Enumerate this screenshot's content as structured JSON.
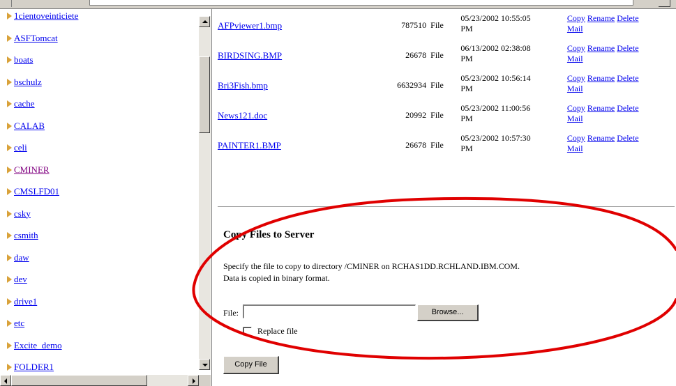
{
  "sidebar": {
    "directories": [
      {
        "label": "1cientoveinticiete",
        "visited": false
      },
      {
        "label": "ASFTomcat",
        "visited": false
      },
      {
        "label": "boats",
        "visited": false
      },
      {
        "label": "bschulz",
        "visited": false
      },
      {
        "label": "cache",
        "visited": false
      },
      {
        "label": "CALAB",
        "visited": false
      },
      {
        "label": "celi",
        "visited": false
      },
      {
        "label": "CMINER",
        "visited": true
      },
      {
        "label": "CMSLFD01",
        "visited": false
      },
      {
        "label": "csky",
        "visited": false
      },
      {
        "label": "csmith",
        "visited": false
      },
      {
        "label": "daw",
        "visited": false
      },
      {
        "label": "dev",
        "visited": false
      },
      {
        "label": "drive1",
        "visited": false
      },
      {
        "label": "etc",
        "visited": false
      },
      {
        "label": "Excite_demo",
        "visited": false
      },
      {
        "label": "FOLDER1",
        "visited": false
      }
    ]
  },
  "files": [
    {
      "name": "AFPviewer1.bmp",
      "size": "787510",
      "type": "File",
      "date": "05/23/2002 10:55:05",
      "ampm": "PM"
    },
    {
      "name": "BIRDSING.BMP",
      "size": "26678",
      "type": "File",
      "date": "06/13/2002 02:38:08",
      "ampm": "PM"
    },
    {
      "name": "Bri3Fish.bmp",
      "size": "6632934",
      "type": "File",
      "date": "05/23/2002 10:56:14",
      "ampm": "PM"
    },
    {
      "name": "News121.doc",
      "size": "20992",
      "type": "File",
      "date": "05/23/2002 11:00:56",
      "ampm": "PM"
    },
    {
      "name": "PAINTER1.BMP",
      "size": "26678",
      "type": "File",
      "date": "05/23/2002 10:57:30",
      "ampm": "PM"
    }
  ],
  "actions": {
    "copy": "Copy",
    "rename": "Rename",
    "delete": "Delete",
    "mail": "Mail"
  },
  "upload": {
    "title": "Copy Files to Server",
    "description_line1": "Specify the file to copy to directory /CMINER on RCHAS1DD.RCHLAND.IBM.COM.",
    "description_line2": "Data is copied in binary format.",
    "file_label": "File:",
    "file_value": "",
    "browse_label": "Browse...",
    "replace_label": "Replace file",
    "replace_checked": false,
    "submit_label": "Copy File"
  },
  "colors": {
    "link": "#0000ee",
    "visited_link": "#800080",
    "folder_icon": "#d9a23a",
    "annotation": "#e00000"
  }
}
